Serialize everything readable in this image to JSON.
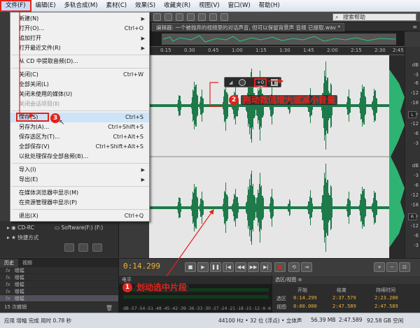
{
  "menubar": {
    "items": [
      "文件(F)",
      "编辑(E)",
      "多轨合成(M)",
      "素材(C)",
      "效果(S)",
      "收藏夹(R)",
      "视图(V)",
      "窗口(W)",
      "帮助(H)"
    ],
    "active_index": 0
  },
  "toolbar": {
    "search_placeholder": "搜索帮助"
  },
  "editor": {
    "tab_label": "编辑器: 一个被抛弃的视频里的对话声音, 但可以保留背景声 音频 已提取.wav *",
    "ruler_labels": [
      "0.15",
      "0.30",
      "0.45",
      "1:00",
      "1:15",
      "1:30",
      "1:45",
      "2:00",
      "2:15",
      "2:30",
      "2:45"
    ],
    "db_labels": [
      "dB",
      "-3",
      "-6",
      "-12",
      "-18",
      "-∞",
      "-12",
      "-6",
      "-3",
      "dB",
      "-3",
      "-6",
      "-12",
      "-18",
      "-∞",
      "-12",
      "-6",
      "-3"
    ],
    "channel_left": "L",
    "channel_right": "R",
    "hud_value": "+0 dB"
  },
  "colors": {
    "accent_red": "#e2231a",
    "wave_green": "#2fc27a",
    "time_yellow": "#f2b233"
  },
  "file_menu": {
    "items": [
      {
        "label": "新建(N)",
        "shortcut": "",
        "submenu": true,
        "disabled": false
      },
      {
        "label": "打开(O)...",
        "shortcut": "Ctrl+O",
        "submenu": false,
        "disabled": false
      },
      {
        "label": "追加打开",
        "shortcut": "",
        "submenu": true,
        "disabled": false
      },
      {
        "label": "打开最近文件(R)",
        "shortcut": "",
        "submenu": true,
        "disabled": false
      },
      {
        "label": "从 CD 中提取音频(D)...",
        "shortcut": "",
        "submenu": false,
        "disabled": false
      },
      {
        "label": "关闭(C)",
        "shortcut": "Ctrl+W",
        "submenu": false,
        "disabled": false
      },
      {
        "label": "全部关闭(L)",
        "shortcut": "",
        "submenu": false,
        "disabled": false
      },
      {
        "label": "关闭未使用的媒体(U)",
        "shortcut": "",
        "submenu": false,
        "disabled": false
      },
      {
        "label": "关闭会话项目(Ⅱ)",
        "shortcut": "",
        "submenu": false,
        "disabled": true
      },
      {
        "label": "保存(S)",
        "shortcut": "Ctrl+S",
        "submenu": false,
        "disabled": false
      },
      {
        "label": "另存为(A)...",
        "shortcut": "Ctrl+Shift+S",
        "submenu": false,
        "disabled": false
      },
      {
        "label": "保存选区为(T)...",
        "shortcut": "Ctrl+Alt+S",
        "submenu": false,
        "disabled": false
      },
      {
        "label": "全部保存(V)",
        "shortcut": "Ctrl+Shift+Alt+S",
        "submenu": false,
        "disabled": false
      },
      {
        "label": "以批处理保存全部音频(B)...",
        "shortcut": "",
        "submenu": false,
        "disabled": false
      },
      {
        "label": "导入(I)",
        "shortcut": "",
        "submenu": true,
        "disabled": false
      },
      {
        "label": "导出(E)",
        "shortcut": "",
        "submenu": true,
        "disabled": false
      },
      {
        "label": "在媒体浏览器中显示(M)",
        "shortcut": "",
        "submenu": false,
        "disabled": false
      },
      {
        "label": "在资源管理器中显示(P)",
        "shortcut": "",
        "submenu": false,
        "disabled": false
      },
      {
        "label": "退出(X)",
        "shortcut": "Ctrl+Q",
        "submenu": false,
        "disabled": false
      }
    ],
    "highlight_index": 9
  },
  "callouts": {
    "c1_num": "1",
    "c1_text": "划动选中片段",
    "c2_num": "2",
    "c2_text": "拖动数值增大或减小音量",
    "c3_num": "3"
  },
  "files_panel": {
    "drive_cd": "CD-RC",
    "shortcut_label": "快捷方式",
    "software_drive": "Software(F:) (F:)"
  },
  "history_panel": {
    "tab_history": "历史",
    "tab_video": "视频",
    "rows": [
      "增幅",
      "增幅",
      "增幅",
      "增幅",
      "增幅"
    ],
    "footer": "15 次撤销"
  },
  "transport": {
    "current_time": "0:14.299"
  },
  "levels": {
    "title": "电平",
    "scale": "dB -57 -54 -51 -48 -45 -42 -39 -36 -33 -30 -27 -24 -21 -18 -15 -12 -9 -6 -3 0"
  },
  "selection_view": {
    "title": "选区/视图 ≡",
    "headers": [
      "开始",
      "结束",
      "持续时间"
    ],
    "rows": [
      {
        "label": "选区",
        "start": "0:14.299",
        "end": "2:37.579",
        "duration": "2:23.280"
      },
      {
        "label": "视图",
        "start": "0:00.000",
        "end": "2:47.589",
        "duration": "2:47.589"
      }
    ]
  },
  "statusbar": {
    "left": "应用 增幅 完成 用时 0.78 秒",
    "items": [
      "44100 Hz • 32 位 (浮点) • 立体声",
      "56.39 MB",
      "2:47.589",
      "92.58 GB 空闲"
    ]
  }
}
